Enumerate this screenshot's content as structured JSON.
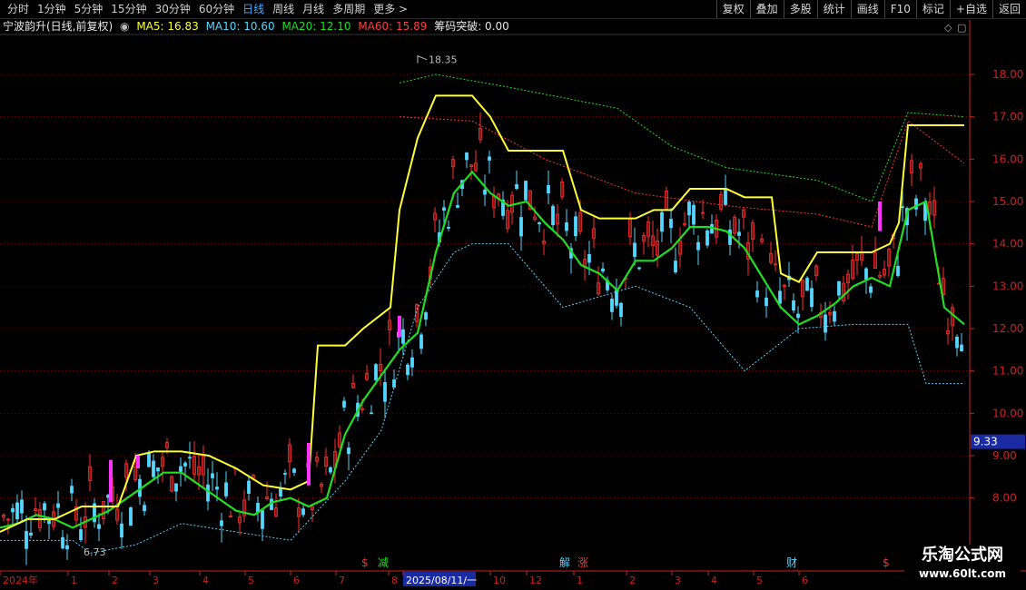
{
  "toolbar": {
    "periods": [
      "分时",
      "1分钟",
      "5分钟",
      "15分钟",
      "30分钟",
      "60分钟",
      "日线",
      "周线",
      "月线",
      "多周期",
      "更多 >"
    ],
    "active_period": "日线",
    "tools": [
      "复权",
      "叠加",
      "多股",
      "统计",
      "画线",
      "F10",
      "标记",
      "+自选",
      "返回"
    ]
  },
  "info": {
    "stock": "宁波韵升(日线,前复权)",
    "ma5": "MA5: 16.83",
    "ma10": "MA10: 10.60",
    "ma20": "MA20: 12.10",
    "ma60": "MA60: 15.89",
    "chip": "筹码突破: 0.00"
  },
  "colors": {
    "up": "#ff3030",
    "down": "#54d6ff",
    "ma_green": "#22dd22",
    "yellow": "#ffff33",
    "magenta": "#ff33ff",
    "grid": "#6a0000",
    "axis": "#cc2020"
  },
  "watermark": {
    "line1": "乐淘公式网",
    "line2": "www.60lt.com"
  },
  "chart_data": {
    "type": "line",
    "title": "宁波韵升(日线,前复权)",
    "ylim": [
      6.3,
      18.9
    ],
    "y_ticks": [
      8.0,
      9.0,
      10.0,
      11.0,
      12.0,
      13.0,
      14.0,
      15.0,
      16.0,
      17.0,
      18.0
    ],
    "current_price_label": "9.33",
    "high_label": "18.35",
    "low_label": "6.73",
    "x_labels": [
      "2024年",
      "1",
      "2",
      "3",
      "4",
      "5",
      "6",
      "7",
      "8",
      "2025/08/11/一",
      "10",
      "12",
      "1",
      "2",
      "3",
      "4",
      "5",
      "6"
    ],
    "event_markers": [
      "$",
      "减",
      "解",
      "涨",
      "财",
      "$"
    ],
    "series": [
      {
        "name": "MA20",
        "color": "#22dd22",
        "x": [
          0,
          20,
          40,
          60,
          80,
          100,
          120,
          140,
          160,
          180,
          200,
          220,
          240,
          260,
          280,
          300,
          320,
          340,
          360,
          380,
          400,
          420,
          440,
          460,
          480,
          500,
          520,
          540,
          560,
          580,
          600,
          620,
          640,
          660,
          680,
          700,
          720,
          740,
          760,
          780,
          800,
          820,
          840,
          860,
          880,
          900,
          920,
          940,
          960,
          980,
          1000,
          1020,
          1040,
          1062
        ],
        "values": [
          7.3,
          7.4,
          7.6,
          7.5,
          7.3,
          7.5,
          7.7,
          8.0,
          8.3,
          8.6,
          8.6,
          8.3,
          8.0,
          7.7,
          7.6,
          7.9,
          8.0,
          7.8,
          8.0,
          9.5,
          10.3,
          10.9,
          11.5,
          11.9,
          13.8,
          15.2,
          15.7,
          15.2,
          14.9,
          15.0,
          14.5,
          14.1,
          13.5,
          13.3,
          12.9,
          13.6,
          13.6,
          13.9,
          14.4,
          14.4,
          14.3,
          13.9,
          13.2,
          12.5,
          12.1,
          12.3,
          12.6,
          13.0,
          13.2,
          13.0,
          14.8,
          15.0,
          12.5,
          12.1
        ]
      },
      {
        "name": "Yellow",
        "color": "#ffff33",
        "x": [
          0,
          30,
          60,
          90,
          130,
          150,
          170,
          200,
          230,
          260,
          290,
          320,
          340,
          350,
          380,
          400,
          430,
          440,
          460,
          480,
          520,
          540,
          560,
          580,
          620,
          640,
          660,
          700,
          720,
          740,
          760,
          800,
          820,
          850,
          860,
          880,
          900,
          940,
          960,
          980,
          990,
          1000,
          1062
        ],
        "values": [
          7.2,
          7.5,
          7.5,
          7.8,
          7.8,
          9.0,
          9.1,
          9.1,
          9.0,
          8.7,
          8.3,
          8.2,
          8.4,
          11.6,
          11.6,
          12.0,
          12.5,
          14.8,
          16.5,
          17.5,
          17.5,
          17.0,
          16.2,
          16.2,
          16.2,
          14.8,
          14.6,
          14.6,
          14.8,
          14.8,
          15.3,
          15.3,
          15.1,
          15.1,
          13.3,
          13.1,
          13.8,
          13.8,
          13.8,
          14.0,
          14.5,
          16.8,
          16.8
        ]
      }
    ]
  }
}
